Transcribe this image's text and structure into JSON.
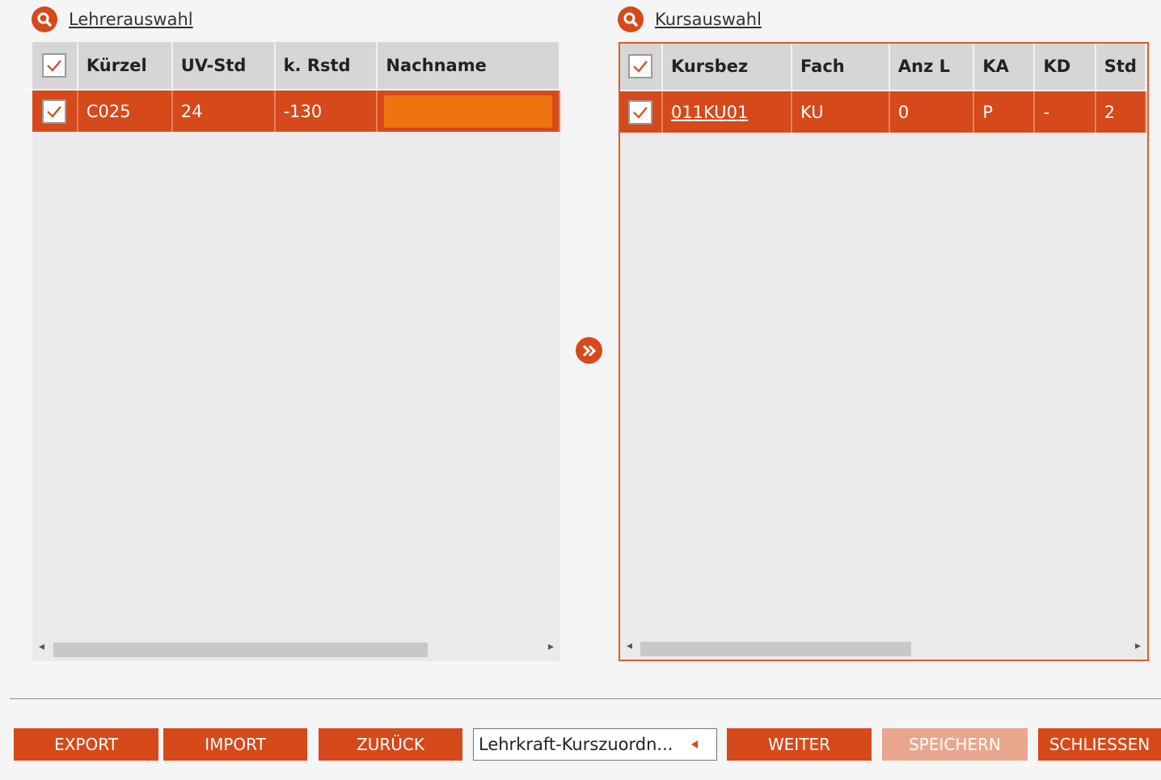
{
  "left_panel": {
    "title": "Lehrerauswahl",
    "columns": [
      "Kürzel",
      "UV-Std",
      "k. Rstd",
      "Nachname"
    ],
    "rows": [
      {
        "kuerzel": "C025",
        "uv_std": "24",
        "k_rstd": "-130",
        "nachname": ""
      }
    ]
  },
  "right_panel": {
    "title": "Kursauswahl",
    "columns": [
      "Kursbez",
      "Fach",
      "Anz L",
      "KA",
      "KD",
      "Std"
    ],
    "rows": [
      {
        "kursbez": "011KU01",
        "fach": "KU",
        "anz_l": "0",
        "ka": "P",
        "kd": "-",
        "std": "2"
      }
    ]
  },
  "footer": {
    "export_label": "EXPORT",
    "import_label": "IMPORT",
    "back_label": "ZURÜCK",
    "step_select_value": "Lehrkraft-Kurszuordn...",
    "next_label": "WEITER",
    "save_label": "SPEICHERN",
    "close_label": "SCHLIESSEN"
  },
  "colors": {
    "accent": "#d5491b",
    "highlight": "#ef730e",
    "disabled": "#e8a68d"
  }
}
